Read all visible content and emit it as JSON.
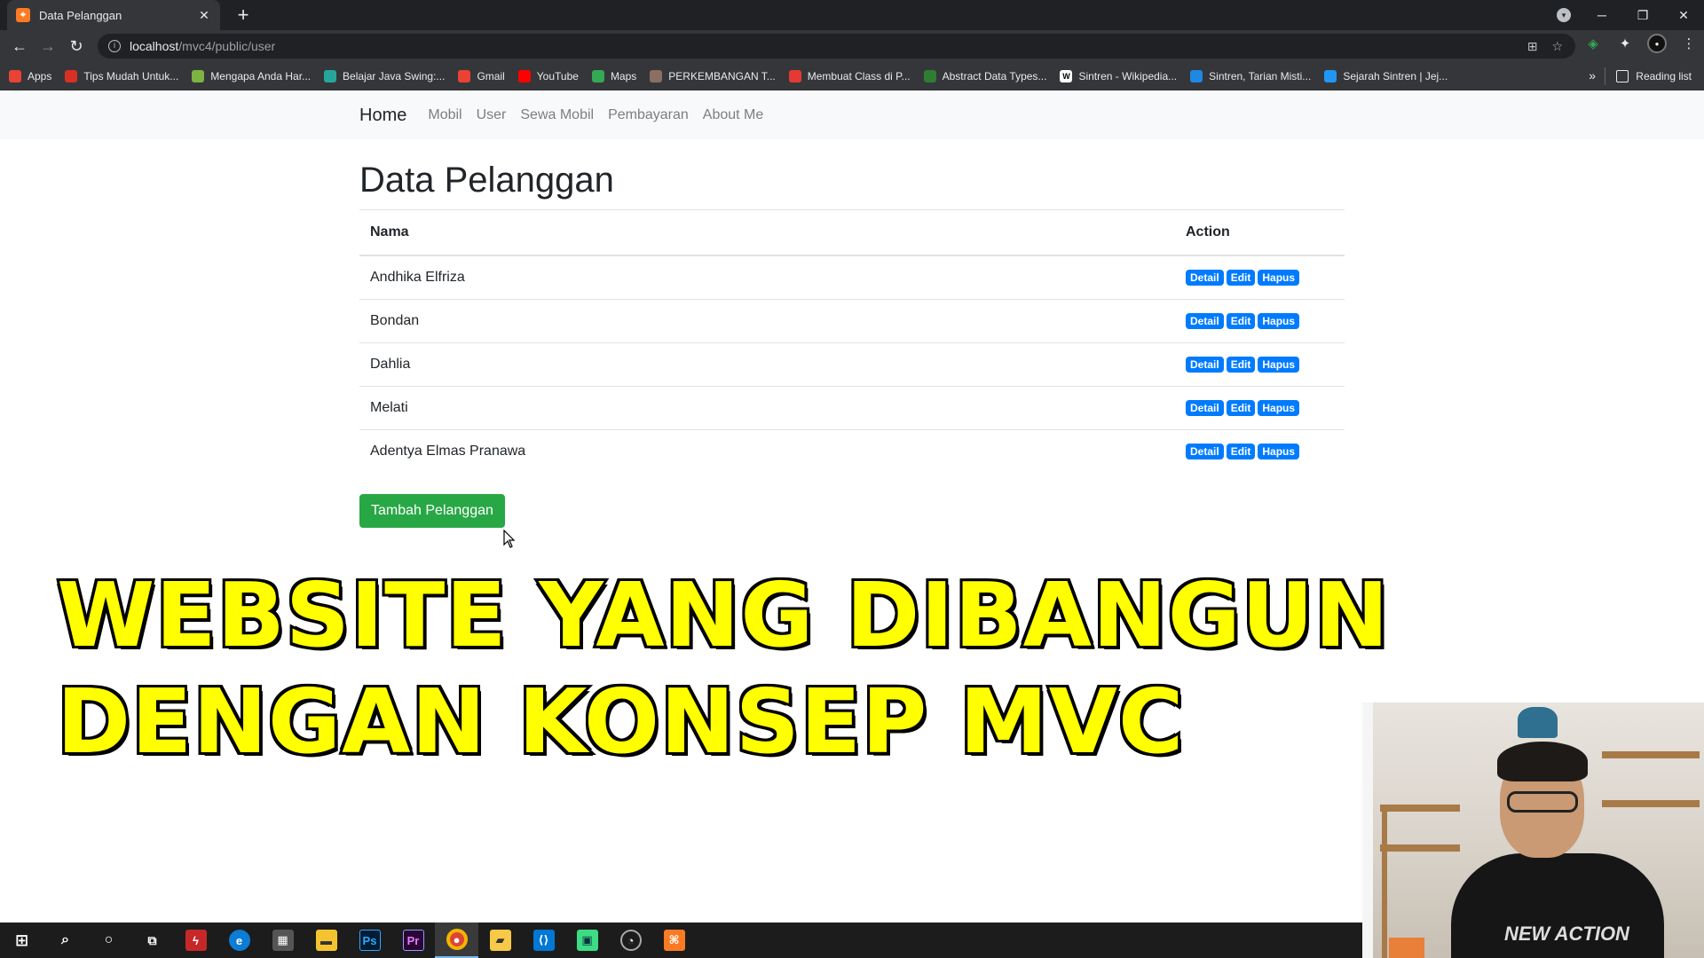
{
  "browser": {
    "tab_title": "Data Pelanggan",
    "tab_favicon_text": "⌖",
    "url_host": "localhost",
    "url_path": "/mvc4/public/user",
    "bookmarks": [
      {
        "label": "Apps",
        "icon": "apps-grid-icon",
        "color": "#ea4335"
      },
      {
        "label": "Tips Mudah Untuk...",
        "icon": "tips-icon",
        "color": "#d93025"
      },
      {
        "label": "Mengapa Anda Har...",
        "icon": "leaf-icon",
        "color": "#7cb342"
      },
      {
        "label": "Belajar Java Swing:...",
        "icon": "java-icon",
        "color": "#26a69a"
      },
      {
        "label": "Gmail",
        "icon": "gmail-icon",
        "color": "#ea4335"
      },
      {
        "label": "YouTube",
        "icon": "youtube-icon",
        "color": "#ff0000"
      },
      {
        "label": "Maps",
        "icon": "maps-pin-icon",
        "color": "#34a853"
      },
      {
        "label": "PERKEMBANGAN T...",
        "icon": "bookmark-site-icon",
        "color": "#8d6e63"
      },
      {
        "label": "Membuat Class di P...",
        "icon": "class-icon",
        "color": "#e53935"
      },
      {
        "label": "Abstract Data Types...",
        "icon": "gfg-icon",
        "color": "#2e7d32"
      },
      {
        "label": "Sintren - Wikipedia...",
        "icon": "wikipedia-icon",
        "color": "#ffffff"
      },
      {
        "label": "Sintren, Tarian Misti...",
        "icon": "jp-icon",
        "color": "#1e88e5"
      },
      {
        "label": "Sejarah Sintren | Jej...",
        "icon": "wordpress-icon",
        "color": "#2196f3"
      }
    ],
    "reading_list": "Reading list"
  },
  "navbar": {
    "brand": "Home",
    "links": [
      "Mobil",
      "User",
      "Sewa Mobil",
      "Pembayaran",
      "About Me"
    ]
  },
  "main": {
    "title": "Data Pelanggan",
    "columns": [
      "Nama",
      "Action"
    ],
    "rows": [
      "Andhika Elfriza",
      "Bondan",
      "Dahlia",
      "Melati",
      "Adentya Elmas Pranawa"
    ],
    "actions": [
      "Detail",
      "Edit",
      "Hapus"
    ],
    "add_button": "Tambah Pelanggan"
  },
  "overlay": {
    "line1": "WEBSITE YANG DIBANGUN",
    "line2": "DENGAN KONSEP MVC",
    "webcam_shirt_text": "NEW ACTION"
  },
  "colors": {
    "primary": "#007bff",
    "success": "#28a745",
    "caption_yellow": "#ffff00"
  }
}
